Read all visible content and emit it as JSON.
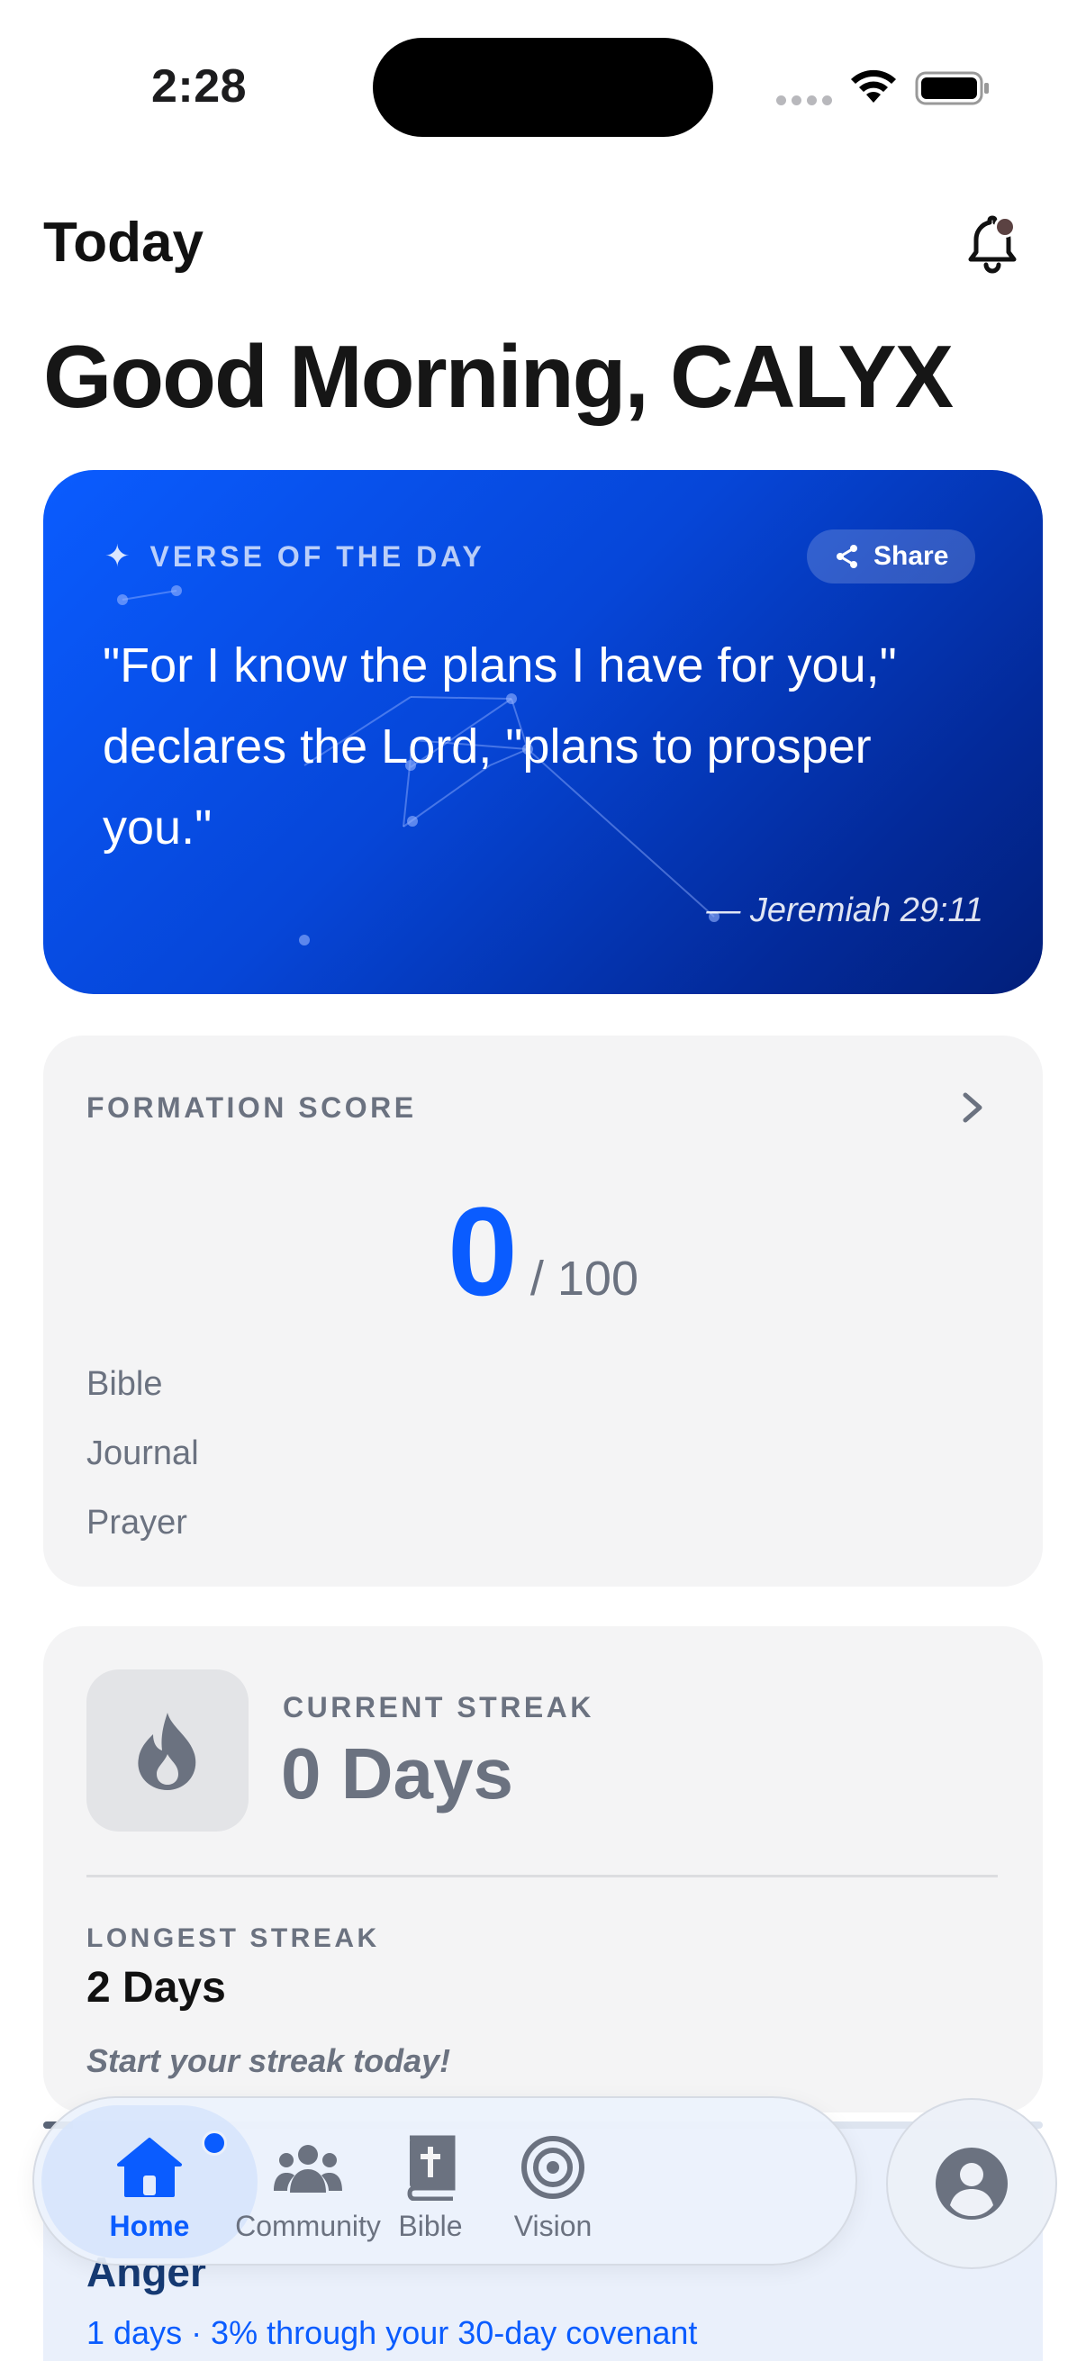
{
  "status_bar": {
    "time": "2:28"
  },
  "header": {
    "title": "Today",
    "greeting": "Good Morning, CALYX",
    "bell_icon": "bell-icon"
  },
  "verse": {
    "label": "VERSE OF THE DAY",
    "share_label": "Share",
    "text": "\"For I know the plans I have for you,\" declares the Lord, \"plans to prosper you.\"",
    "reference": "— Jeremiah 29:11",
    "colors": {
      "start": "#0a5cff",
      "end": "#021f7a"
    }
  },
  "formation": {
    "label": "FORMATION SCORE",
    "score": "0",
    "max": "/ 100",
    "rows": [
      "Bible",
      "Journal",
      "Prayer"
    ]
  },
  "streak": {
    "current_label": "CURRENT STREAK",
    "current_value": "0 Days",
    "longest_label": "LONGEST STREAK",
    "longest_value": "2 Days",
    "hint": "Start your streak today!"
  },
  "covenant": {
    "title": "Anger",
    "subtitle": "1 days · 3% through your 30-day covenant",
    "progress_percent": 3
  },
  "tabs": [
    {
      "label": "Home",
      "icon": "home-icon",
      "active": true
    },
    {
      "label": "Community",
      "icon": "community-icon",
      "active": false
    },
    {
      "label": "Bible",
      "icon": "bible-icon",
      "active": false
    },
    {
      "label": "Vision",
      "icon": "target-icon",
      "active": false
    }
  ],
  "profile_icon": "profile-icon",
  "accent_color": "#0a5cff"
}
